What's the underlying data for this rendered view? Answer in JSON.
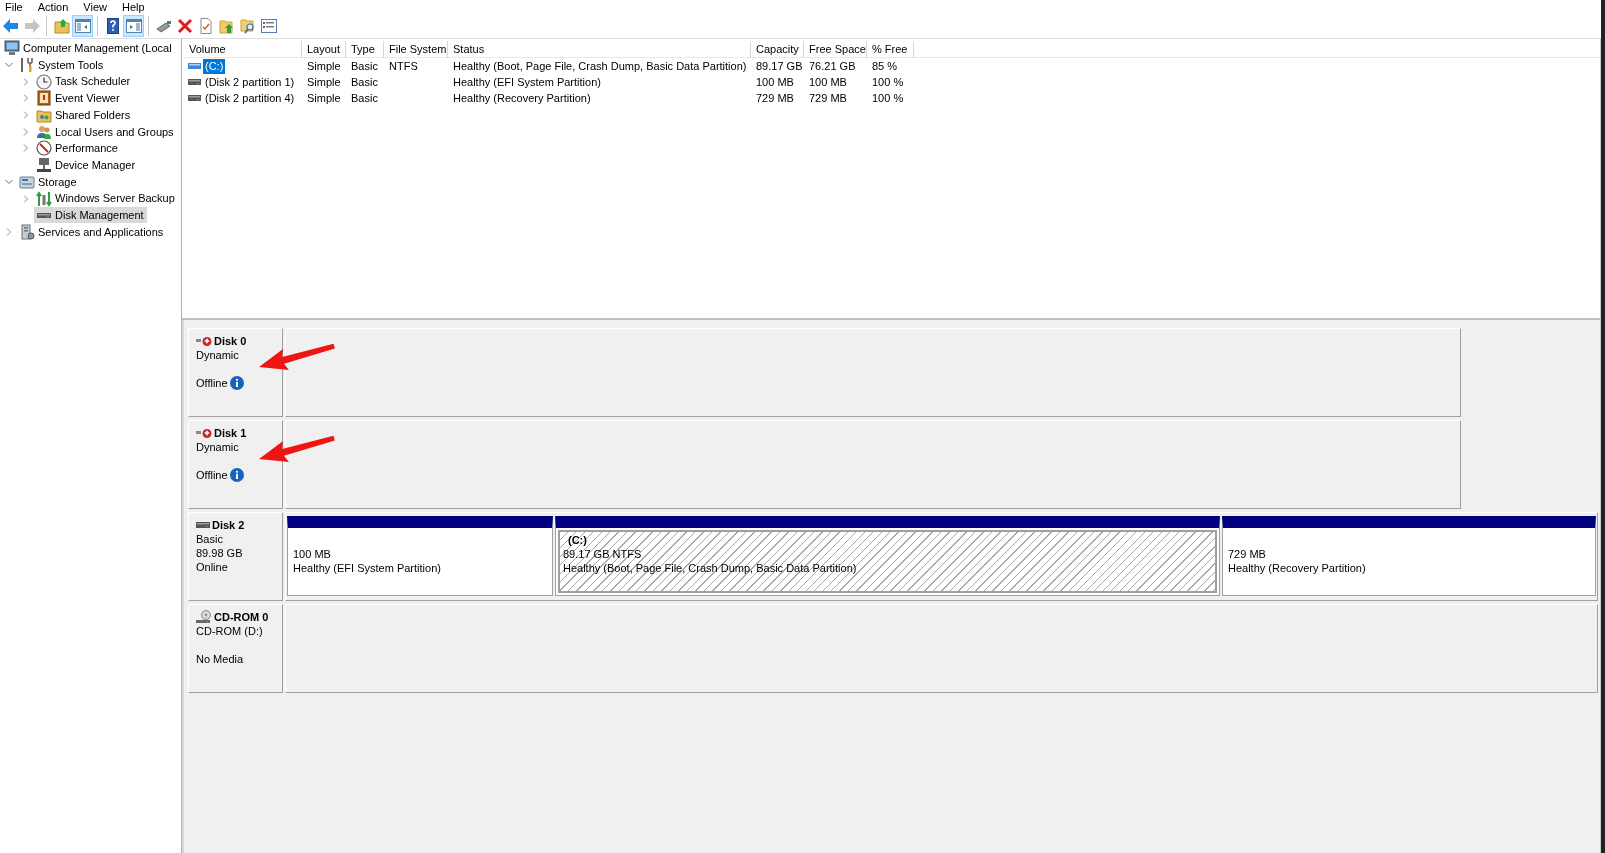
{
  "menu": [
    "File",
    "Action",
    "View",
    "Help"
  ],
  "toolbar": [
    {
      "kind": "back",
      "pressed": false,
      "disabled": false
    },
    {
      "kind": "forward",
      "pressed": false,
      "disabled": true
    },
    {
      "kind": "separator"
    },
    {
      "kind": "up",
      "pressed": false,
      "disabled": false
    },
    {
      "kind": "console_tree",
      "pressed": true,
      "disabled": false
    },
    {
      "kind": "separator"
    },
    {
      "kind": "help",
      "pressed": false,
      "disabled": false
    },
    {
      "kind": "action_pane",
      "pressed": true,
      "disabled": false
    },
    {
      "kind": "separator"
    },
    {
      "kind": "connect",
      "pressed": false,
      "disabled": false
    },
    {
      "kind": "delete",
      "pressed": false,
      "disabled": false
    },
    {
      "kind": "properties",
      "pressed": false,
      "disabled": false
    },
    {
      "kind": "export",
      "pressed": false,
      "disabled": false
    },
    {
      "kind": "find",
      "pressed": false,
      "disabled": false
    },
    {
      "kind": "list",
      "pressed": false,
      "disabled": false
    }
  ],
  "tree": [
    {
      "label": "Computer Management (Local",
      "kind": "computer",
      "selected": false,
      "children": [
        {
          "label": "System Tools",
          "kind": "tools",
          "expandable": true,
          "expanded": true,
          "selected": false,
          "children": [
            {
              "label": "Task Scheduler",
              "kind": "scheduler",
              "expandable": true,
              "expanded": false,
              "selected": false
            },
            {
              "label": "Event Viewer",
              "kind": "events",
              "expandable": true,
              "expanded": false,
              "selected": false
            },
            {
              "label": "Shared Folders",
              "kind": "shares",
              "expandable": true,
              "expanded": false,
              "selected": false
            },
            {
              "label": "Local Users and Groups",
              "kind": "users",
              "expandable": true,
              "expanded": false,
              "selected": false
            },
            {
              "label": "Performance",
              "kind": "performance",
              "expandable": true,
              "expanded": false,
              "selected": false
            },
            {
              "label": "Device Manager",
              "kind": "devices",
              "expandable": false,
              "expanded": false,
              "selected": false
            }
          ]
        },
        {
          "label": "Storage",
          "kind": "storage",
          "expandable": true,
          "expanded": true,
          "selected": false,
          "children": [
            {
              "label": "Windows Server Backup",
              "kind": "backup",
              "expandable": true,
              "expanded": false,
              "selected": false
            },
            {
              "label": "Disk Management",
              "kind": "disks",
              "expandable": false,
              "expanded": false,
              "selected": true
            }
          ]
        },
        {
          "label": "Services and Applications",
          "kind": "services",
          "expandable": true,
          "expanded": false,
          "selected": false
        }
      ]
    }
  ],
  "volume_table": {
    "columns": [
      "Volume",
      "Layout",
      "Type",
      "File System",
      "Status",
      "Capacity",
      "Free Space",
      "% Free"
    ],
    "rows": [
      {
        "selected": true,
        "volume": "(C:)",
        "layout": "Simple",
        "type": "Basic",
        "file_system": "NTFS",
        "status": "Healthy (Boot, Page File, Crash Dump, Basic Data Partition)",
        "capacity": "89.17 GB",
        "free_space": "76.21 GB",
        "percent_free": "85 %"
      },
      {
        "selected": false,
        "volume": "(Disk 2 partition 1)",
        "layout": "Simple",
        "type": "Basic",
        "status": "Healthy (EFI System Partition)",
        "capacity": "100 MB",
        "free_space": "100 MB",
        "percent_free": "100 %"
      },
      {
        "selected": false,
        "volume": "(Disk 2 partition 4)",
        "layout": "Simple",
        "type": "Basic",
        "status": "Healthy (Recovery Partition)",
        "capacity": "729 MB",
        "free_space": "729 MB",
        "percent_free": "100 %"
      }
    ]
  },
  "disks": [
    {
      "kind": "disk",
      "name": "Disk 0",
      "type": "Dynamic",
      "status": "Offline",
      "offline": true,
      "info": true,
      "annotation_arrow": true
    },
    {
      "kind": "disk",
      "name": "Disk 1",
      "type": "Dynamic",
      "status": "Offline",
      "offline": true,
      "info": true,
      "annotation_arrow": true
    },
    {
      "kind": "disk",
      "name": "Disk 2",
      "type": "Basic",
      "size": "89.98 GB",
      "status": "Online",
      "offline": false,
      "info": false,
      "annotation_arrow": false,
      "partitions": [
        {
          "size": "100 MB",
          "status": "Healthy (EFI System Partition)",
          "selected": false
        },
        {
          "label": "(C:)",
          "size": "89.17 GB NTFS",
          "status": "Healthy (Boot, Page File, Crash Dump, Basic Data Partition)",
          "selected": true
        },
        {
          "size": "729 MB",
          "status": "Healthy (Recovery Partition)",
          "selected": false
        }
      ]
    },
    {
      "kind": "cdrom",
      "name": "CD-ROM 0",
      "type": "CD-ROM (D:)",
      "status": "No Media",
      "offline": false,
      "info": false,
      "annotation_arrow": false
    }
  ]
}
